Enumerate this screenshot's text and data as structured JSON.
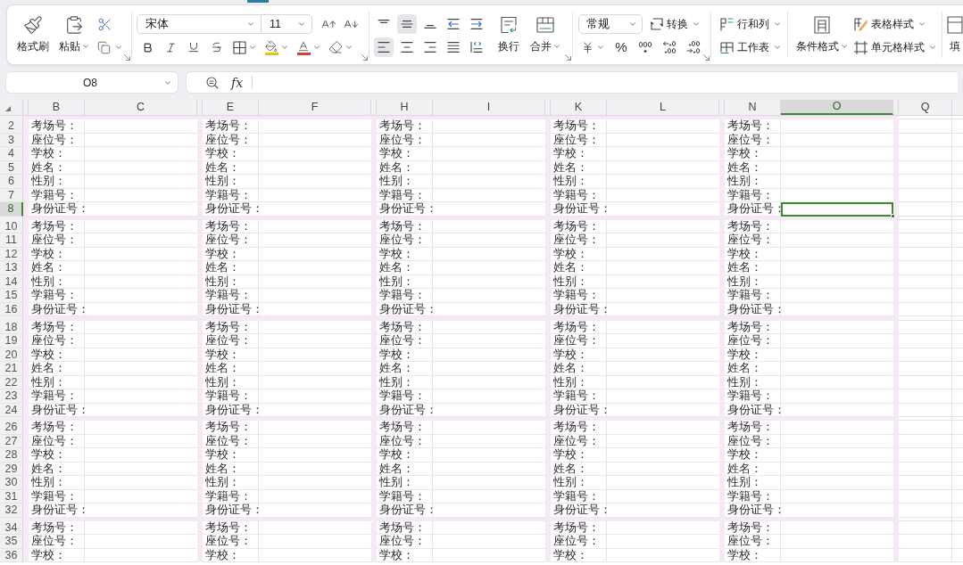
{
  "ribbon": {
    "clipboard": {
      "format_painter": "格式刷",
      "paste": "粘贴"
    },
    "font": {
      "name": "宋体",
      "size": "11"
    },
    "alignment": {
      "buttons": [
        {
          "kind": "top",
          "selected": false
        },
        {
          "kind": "middle",
          "selected": true
        },
        {
          "kind": "bottom",
          "selected": false
        },
        {
          "kind": "outdent",
          "selected": false
        },
        {
          "kind": "indent",
          "selected": false
        },
        {
          "kind": "left",
          "selected": true
        },
        {
          "kind": "center",
          "selected": false
        },
        {
          "kind": "right",
          "selected": false
        },
        {
          "kind": "justify",
          "selected": false
        },
        {
          "kind": "distributed",
          "selected": false
        }
      ],
      "wrap": "换行",
      "merge": "合并"
    },
    "number": {
      "format": "常规",
      "convert": "转换",
      "percent": "%"
    },
    "cells": {
      "rows_columns": "行和列",
      "worksheet": "工作表"
    },
    "styles": {
      "conditional": "条件格式",
      "table_style": "表格样式",
      "cell_style": "单元格样式"
    },
    "fill": "填"
  },
  "formula_bar": {
    "name_box": "O8",
    "function_label": "fx"
  },
  "sheet": {
    "columns": [
      {
        "kind": "narrow"
      },
      {
        "kind": "label",
        "label": "B",
        "selected": false
      },
      {
        "kind": "value",
        "label": "C",
        "selected": false
      },
      {
        "kind": "narrow"
      },
      {
        "kind": "label",
        "label": "E",
        "selected": false
      },
      {
        "kind": "value",
        "label": "F",
        "selected": false
      },
      {
        "kind": "narrow"
      },
      {
        "kind": "label",
        "label": "H",
        "selected": false
      },
      {
        "kind": "value",
        "label": "I",
        "selected": false
      },
      {
        "kind": "narrow"
      },
      {
        "kind": "label",
        "label": "K",
        "selected": false
      },
      {
        "kind": "value",
        "label": "L",
        "selected": false
      },
      {
        "kind": "narrow"
      },
      {
        "kind": "label",
        "label": "N",
        "selected": false
      },
      {
        "kind": "value",
        "label": "O",
        "selected": true
      },
      {
        "kind": "narrow"
      },
      {
        "kind": "plain",
        "label": "Q",
        "selected": false
      }
    ],
    "rows": [
      {
        "kind": "gap"
      },
      {
        "kind": "data",
        "number": "2",
        "selected": false,
        "cells": [
          "考场号：",
          "考场号：",
          "考场号：",
          "考场号：",
          "考场号："
        ]
      },
      {
        "kind": "data",
        "number": "3",
        "selected": false,
        "cells": [
          "座位号：",
          "座位号：",
          "座位号：",
          "座位号：",
          "座位号："
        ]
      },
      {
        "kind": "data",
        "number": "4",
        "selected": false,
        "cells": [
          "学校：",
          "学校：",
          "学校：",
          "学校：",
          "学校："
        ]
      },
      {
        "kind": "data",
        "number": "5",
        "selected": false,
        "cells": [
          "姓名：",
          "姓名：",
          "姓名：",
          "姓名：",
          "姓名："
        ]
      },
      {
        "kind": "data",
        "number": "6",
        "selected": false,
        "cells": [
          "性别：",
          "性别：",
          "性别：",
          "性别：",
          "性别："
        ]
      },
      {
        "kind": "data",
        "number": "7",
        "selected": false,
        "cells": [
          "学籍号：",
          "学籍号：",
          "学籍号：",
          "学籍号：",
          "学籍号："
        ]
      },
      {
        "kind": "data",
        "number": "8",
        "selected": true,
        "cells": [
          "身份证号：",
          "身份证号：",
          "身份证号：",
          "身份证号：",
          "身份证号："
        ]
      },
      {
        "kind": "gap"
      },
      {
        "kind": "data",
        "number": "10",
        "selected": false,
        "cells": [
          "考场号：",
          "考场号：",
          "考场号：",
          "考场号：",
          "考场号："
        ]
      },
      {
        "kind": "data",
        "number": "11",
        "selected": false,
        "cells": [
          "座位号：",
          "座位号：",
          "座位号：",
          "座位号：",
          "座位号："
        ]
      },
      {
        "kind": "data",
        "number": "12",
        "selected": false,
        "cells": [
          "学校：",
          "学校：",
          "学校：",
          "学校：",
          "学校："
        ]
      },
      {
        "kind": "data",
        "number": "13",
        "selected": false,
        "cells": [
          "姓名：",
          "姓名：",
          "姓名：",
          "姓名：",
          "姓名："
        ]
      },
      {
        "kind": "data",
        "number": "14",
        "selected": false,
        "cells": [
          "性别：",
          "性别：",
          "性别：",
          "性别：",
          "性别："
        ]
      },
      {
        "kind": "data",
        "number": "15",
        "selected": false,
        "cells": [
          "学籍号：",
          "学籍号：",
          "学籍号：",
          "学籍号：",
          "学籍号："
        ]
      },
      {
        "kind": "data",
        "number": "16",
        "selected": false,
        "cells": [
          "身份证号：",
          "身份证号：",
          "身份证号：",
          "身份证号：",
          "身份证号："
        ]
      },
      {
        "kind": "gap"
      },
      {
        "kind": "data",
        "number": "18",
        "selected": false,
        "cells": [
          "考场号：",
          "考场号：",
          "考场号：",
          "考场号：",
          "考场号："
        ]
      },
      {
        "kind": "data",
        "number": "19",
        "selected": false,
        "cells": [
          "座位号：",
          "座位号：",
          "座位号：",
          "座位号：",
          "座位号："
        ]
      },
      {
        "kind": "data",
        "number": "20",
        "selected": false,
        "cells": [
          "学校：",
          "学校：",
          "学校：",
          "学校：",
          "学校："
        ]
      },
      {
        "kind": "data",
        "number": "21",
        "selected": false,
        "cells": [
          "姓名：",
          "姓名：",
          "姓名：",
          "姓名：",
          "姓名："
        ]
      },
      {
        "kind": "data",
        "number": "22",
        "selected": false,
        "cells": [
          "性别：",
          "性别：",
          "性别：",
          "性别：",
          "性别："
        ]
      },
      {
        "kind": "data",
        "number": "23",
        "selected": false,
        "cells": [
          "学籍号：",
          "学籍号：",
          "学籍号：",
          "学籍号：",
          "学籍号："
        ]
      },
      {
        "kind": "data",
        "number": "24",
        "selected": false,
        "cells": [
          "身份证号：",
          "身份证号：",
          "身份证号：",
          "身份证号：",
          "身份证号："
        ]
      },
      {
        "kind": "gap"
      },
      {
        "kind": "data",
        "number": "26",
        "selected": false,
        "cells": [
          "考场号：",
          "考场号：",
          "考场号：",
          "考场号：",
          "考场号："
        ]
      },
      {
        "kind": "data",
        "number": "27",
        "selected": false,
        "cells": [
          "座位号：",
          "座位号：",
          "座位号：",
          "座位号：",
          "座位号："
        ]
      },
      {
        "kind": "data",
        "number": "28",
        "selected": false,
        "cells": [
          "学校：",
          "学校：",
          "学校：",
          "学校：",
          "学校："
        ]
      },
      {
        "kind": "data",
        "number": "29",
        "selected": false,
        "cells": [
          "姓名：",
          "姓名：",
          "姓名：",
          "姓名：",
          "姓名："
        ]
      },
      {
        "kind": "data",
        "number": "30",
        "selected": false,
        "cells": [
          "性别：",
          "性别：",
          "性别：",
          "性别：",
          "性别："
        ]
      },
      {
        "kind": "data",
        "number": "31",
        "selected": false,
        "cells": [
          "学籍号：",
          "学籍号：",
          "学籍号：",
          "学籍号：",
          "学籍号："
        ]
      },
      {
        "kind": "data",
        "number": "32",
        "selected": false,
        "cells": [
          "身份证号：",
          "身份证号：",
          "身份证号：",
          "身份证号：",
          "身份证号："
        ]
      },
      {
        "kind": "gap"
      },
      {
        "kind": "data",
        "number": "34",
        "selected": false,
        "cells": [
          "考场号：",
          "考场号：",
          "考场号：",
          "考场号：",
          "考场号："
        ]
      },
      {
        "kind": "data",
        "number": "35",
        "selected": false,
        "cells": [
          "座位号：",
          "座位号：",
          "座位号：",
          "座位号：",
          "座位号："
        ]
      },
      {
        "kind": "data",
        "number": "36",
        "selected": false,
        "cells": [
          "学校：",
          "学校：",
          "学校：",
          "学校：",
          "学校："
        ]
      }
    ]
  }
}
